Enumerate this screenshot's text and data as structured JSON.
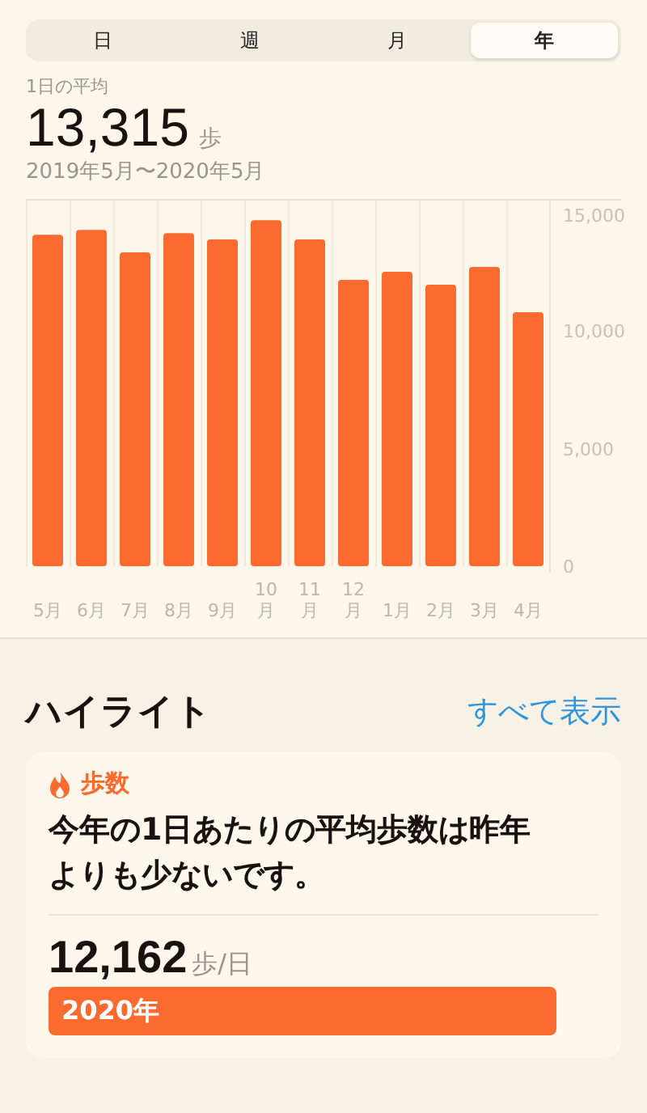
{
  "tabs": [
    {
      "label": "日",
      "selected": false
    },
    {
      "label": "週",
      "selected": false
    },
    {
      "label": "月",
      "selected": false
    },
    {
      "label": "年",
      "selected": true
    }
  ],
  "summary": {
    "label": "1日の平均",
    "value": "13,315",
    "unit": "歩",
    "range": "2019年5月〜2020年5月"
  },
  "chart_data": {
    "type": "bar",
    "categories": [
      "5月",
      "6月",
      "7月",
      "8月",
      "9月",
      "10月",
      "11月",
      "12月",
      "1月",
      "2月",
      "3月",
      "4月"
    ],
    "series": [
      {
        "color": "#fb6a2f",
        "values": [
          14100,
          14300,
          13350,
          14170,
          13900,
          14720,
          13900,
          12180,
          12520,
          11970,
          12730,
          10800
        ]
      }
    ],
    "ylim": [
      0,
      15000
    ],
    "yticks": [
      {
        "value": 0,
        "label": "0"
      },
      {
        "value": 5000,
        "label": "5,000"
      },
      {
        "value": 10000,
        "label": "10,000"
      },
      {
        "value": 15000,
        "label": "15,000"
      }
    ]
  },
  "highlights": {
    "title": "ハイライト",
    "link": "すべて表示",
    "card": {
      "category": "歩数",
      "message": "今年の1日あたりの平均歩数は昨年よりも少ないです。",
      "value": "12,162",
      "unit": "歩/日",
      "bars": [
        {
          "label": "2020年",
          "color": "#fb6a2f"
        }
      ]
    }
  }
}
